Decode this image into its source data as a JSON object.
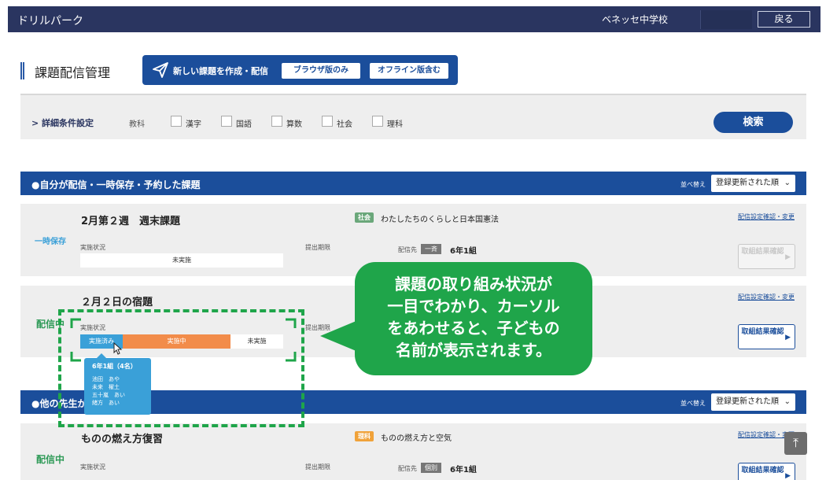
{
  "header": {
    "app_title": "ドリルパーク",
    "school_name": "ベネッセ中学校",
    "back_label": "戻る"
  },
  "page": {
    "title": "課題配信管理",
    "create_label": "新しい課題を作成・配信",
    "browser_only_label": "ブラウザ版のみ",
    "offline_label": "オフライン版含む"
  },
  "filter": {
    "detail_label": "> 詳細条件設定",
    "subject_label": "教科",
    "subjects": [
      "漢字",
      "国語",
      "算数",
      "社会",
      "理科"
    ],
    "search_label": "検索"
  },
  "section_mine": {
    "title": "●自分が配信・一時保存・予約した課題",
    "sort_label": "並べ替え",
    "sort_value": "登録更新された順"
  },
  "section_others": {
    "title": "●他の先生が",
    "sort_label": "並べ替え",
    "sort_value": "登録更新された順"
  },
  "cards": [
    {
      "status": "一時保存",
      "title": "2月第２週　週末課題",
      "subject_tag": "社会",
      "subject_text": "わたしたちのくらしと日本国憲法",
      "link": "配信設定確認・変更",
      "status_label": "実施状況",
      "status_value": "未実施",
      "deadline_label": "提出期限",
      "dest_label": "配信先",
      "dest_tag": "一斉",
      "dest_class": "6年1組",
      "result_label": "取組結果確認",
      "colors": {
        "tag": "#6aa77a"
      }
    },
    {
      "status": "配信中",
      "title": "２月２日の宿題",
      "link": "配信設定確認・変更",
      "status_label": "実施状況",
      "deadline_label": "提出期限",
      "progress": {
        "done": "実施済み",
        "doing": "実施中",
        "notyet": "未実施",
        "done_fraction": 0.21,
        "doing_fraction": 0.53
      },
      "result_label": "取組結果確認"
    },
    {
      "status": "配信中",
      "title": "ものの燃え方復習",
      "subject_tag": "理科",
      "subject_text": "ものの燃え方と空気",
      "link": "配信設定確認・変更",
      "status_label": "実施状況",
      "deadline_label": "提出期限",
      "dest_label": "配信先",
      "dest_tag": "個別",
      "dest_class": "6年1組",
      "result_label": "取組結果確認",
      "colors": {
        "tag": "#f0a23a"
      }
    }
  ],
  "tooltip": {
    "title": "6年1組（4名）",
    "names": [
      "池田　あや",
      "未来　櫂土",
      "五十嵐　あい",
      "緒方　あい"
    ]
  },
  "callout": {
    "lines": [
      "課題の取り組み状況が",
      "一目でわかり、カーソル",
      "をあわせると、子どもの",
      "名前が表示されます。"
    ]
  },
  "colors": {
    "navy": "#2a3560",
    "blue": "#1b4e9b",
    "green": "#1fa54a",
    "done": "#3aa0d8",
    "doing": "#f28c4a"
  }
}
